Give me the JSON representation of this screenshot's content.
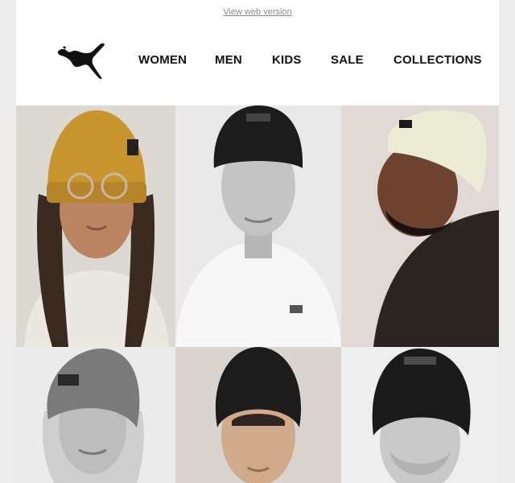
{
  "preheader": {
    "link_text": "View web version"
  },
  "brand": {
    "name": "PUMA",
    "logo_icon": "puma-cat-logo-icon"
  },
  "nav": {
    "items": [
      {
        "label": "WOMEN"
      },
      {
        "label": "MEN"
      },
      {
        "label": "KIDS"
      },
      {
        "label": "SALE"
      },
      {
        "label": "COLLECTIONS"
      }
    ]
  },
  "grid": {
    "tiles": [
      {
        "name": "portrait-woman-mustard-beanie"
      },
      {
        "name": "portrait-man-black-beanie"
      },
      {
        "name": "portrait-man-cream-beanie"
      },
      {
        "name": "portrait-woman-grey-beanie"
      },
      {
        "name": "portrait-young-man-black-beanie"
      },
      {
        "name": "portrait-bearded-man-black-beanie"
      }
    ]
  },
  "colors": {
    "background": "#ececec",
    "email_bg": "#ffffff",
    "text": "#111111",
    "muted_link": "#8a8a8a",
    "mustard": "#c9952e",
    "cream": "#ecebd6"
  }
}
